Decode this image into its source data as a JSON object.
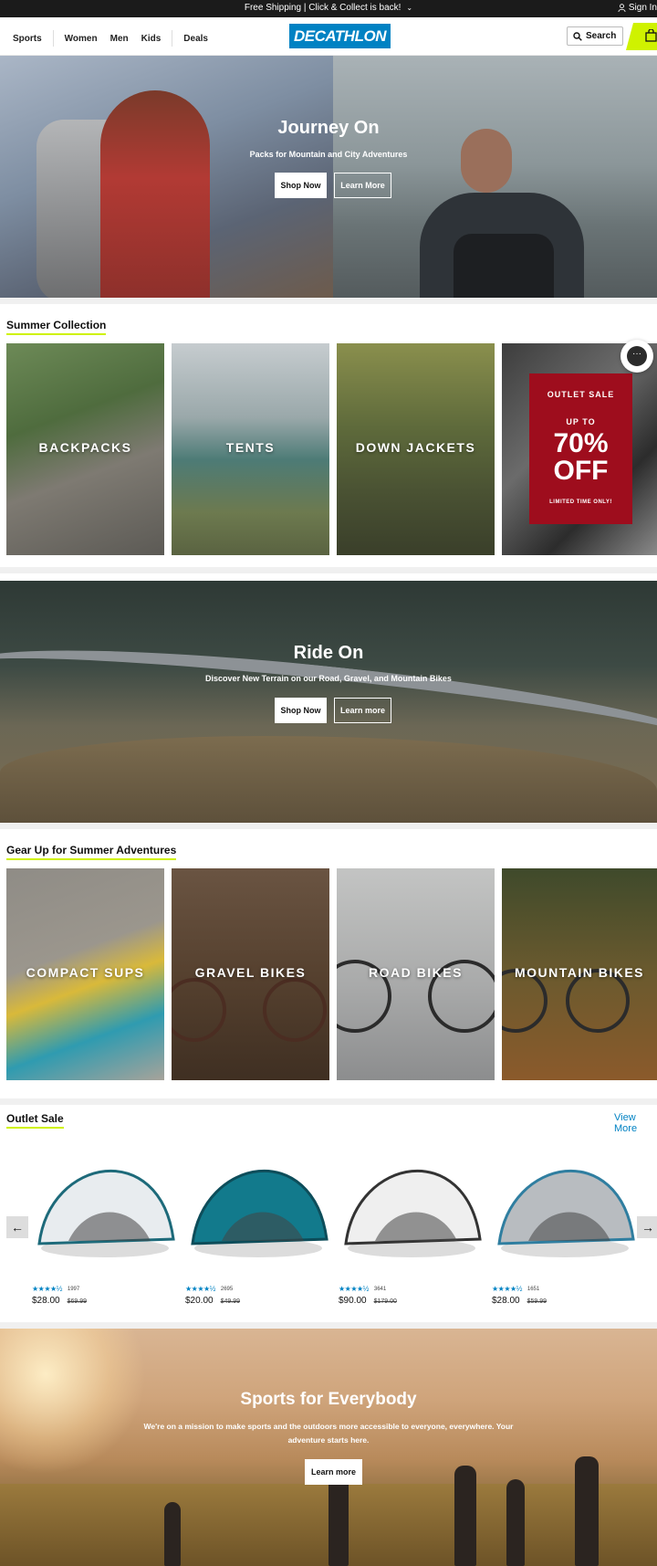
{
  "topbar": {
    "shipping": "Free Shipping | Click & Collect is back!",
    "signin": "Sign In"
  },
  "header": {
    "nav": [
      "Sports",
      "Women",
      "Men",
      "Kids",
      "Deals"
    ],
    "logo": "DECATHLON",
    "search_label": "Search"
  },
  "hero": {
    "title": "Journey On",
    "subtitle": "Packs for Mountain and City Adventures",
    "shop_now": "Shop Now",
    "learn_more": "Learn More"
  },
  "summer": {
    "title": "Summer Collection",
    "tiles": [
      "BACKPACKS",
      "TENTS",
      "DOWN JACKETS"
    ],
    "outlet": {
      "line1": "OUTLET SALE",
      "line2": "UP TO",
      "line3": "70%",
      "line4": "OFF",
      "line5": "LIMITED TIME ONLY!"
    }
  },
  "ride": {
    "title": "Ride On",
    "subtitle": "Discover New Terrain on our Road, Gravel, and Mountain Bikes",
    "shop_now": "Shop Now",
    "learn_more": "Learn more"
  },
  "gear": {
    "title": "Gear Up for Summer Adventures",
    "tiles": [
      "COMPACT SUPS",
      "GRAVEL BIKES",
      "ROAD BIKES",
      "MOUNTAIN BIKES"
    ]
  },
  "outlet_sale": {
    "title": "Outlet Sale",
    "view_more": "View More",
    "products": [
      {
        "rating": 4.5,
        "reviews": "1997",
        "price": "$28.00",
        "was": "$69.99",
        "color": "#e8ecef",
        "accent": "#1d6a7a"
      },
      {
        "rating": 4.5,
        "reviews": "2695",
        "price": "$20.00",
        "was": "$49.99",
        "color": "#127a8c",
        "accent": "#0d4d5a"
      },
      {
        "rating": 4.5,
        "reviews": "3641",
        "price": "$90.00",
        "was": "$179.00",
        "color": "#efefef",
        "accent": "#333333"
      },
      {
        "rating": 4.5,
        "reviews": "1651",
        "price": "$28.00",
        "was": "$59.99",
        "color": "#b8bcc0",
        "accent": "#2f7ea0"
      }
    ]
  },
  "sports": {
    "title": "Sports for Everybody",
    "text": "We're on a mission to make sports and the outdoors more accessible to everyone, everywhere. Your adventure starts here.",
    "learn_more": "Learn more"
  },
  "colors": {
    "brand": "#0082c3",
    "accent": "#cff200",
    "outlet_red": "#9e0d1d"
  },
  "icons": [
    "chevron-down-icon",
    "user-icon",
    "search-icon",
    "cart-icon",
    "chat-icon",
    "arrow-left-icon",
    "arrow-right-icon",
    "star-icon"
  ]
}
